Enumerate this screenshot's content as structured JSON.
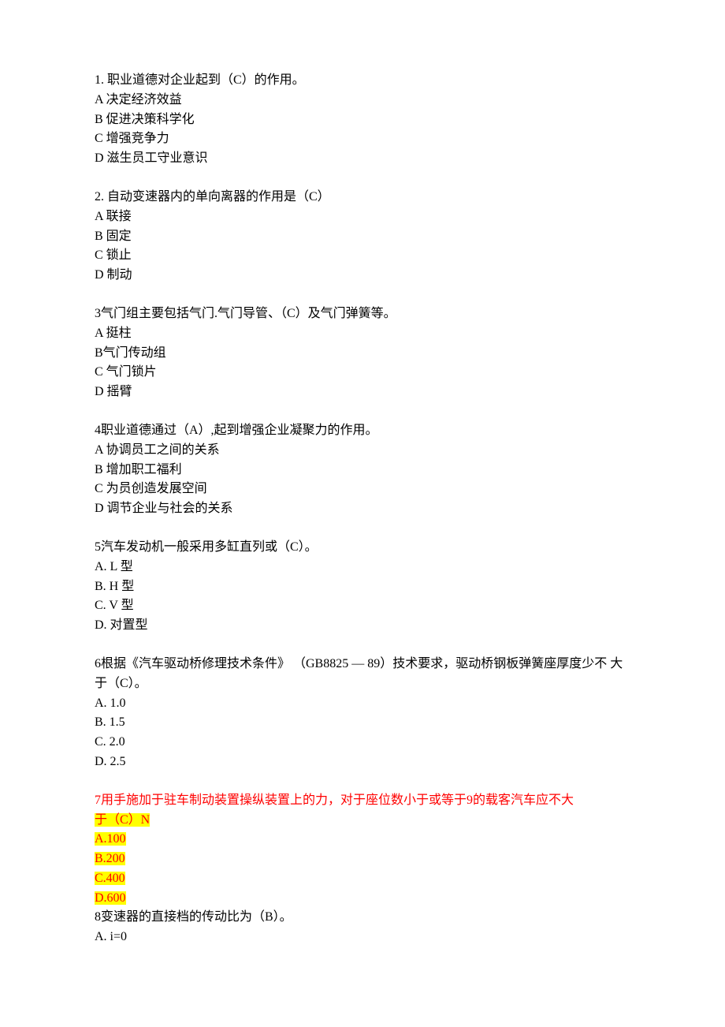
{
  "q1": {
    "stem": "1. 职业道德对企业起到（C）的作用。",
    "opts": [
      "A 决定经济效益",
      "B 促进决策科学化",
      "C 增强竞争力",
      "D 滋生员工守业意识"
    ]
  },
  "q2": {
    "stem": "2. 自动变速器内的单向离器的作用是（C）",
    "opts": [
      "A 联接",
      "B 固定",
      "C 锁止",
      "D 制动"
    ]
  },
  "q3": {
    "stem": "3气门组主要包括气门.气门导管、（C）及气门弹簧等。",
    "opts": [
      "A 挺柱",
      "B气门传动组",
      "C 气门锁片",
      "D 摇臂"
    ]
  },
  "q4": {
    "stem": "4职业道德通过（A）,起到增强企业凝聚力的作用。",
    "opts": [
      "A 协调员工之间的关系",
      "B 增加职工福利",
      "C 为员创造发展空间",
      "D 调节企业与社会的关系"
    ]
  },
  "q5": {
    "stem": "5汽车发动机一般采用多缸直列或（C）。",
    "opts": [
      "A.  L 型",
      "B.  H 型",
      "C.  V 型",
      "D.  对置型"
    ]
  },
  "q6": {
    "stem": "6根据《汽车驱动桥修理技术条件》 （GB8825 —  89）技术要求，驱动桥钢板弹簧座厚度少不 大于（C）。",
    "opts": [
      "A. 1.0",
      "B. 1.5",
      "C. 2.0",
      "D. 2.5"
    ]
  },
  "q7": {
    "stem_line1": "  7用手施加于驻车制动装置操纵装置上的力，对于座位数小于或等于9的载客汽车应不大",
    "stem_line2": "于（C）N",
    "opts": [
      "A.100",
      "B.200",
      "C.400",
      "D.600"
    ]
  },
  "q8": {
    "stem": "8变速器的直接档的传动比为（B）。",
    "opts": [
      "A. i=0"
    ]
  }
}
